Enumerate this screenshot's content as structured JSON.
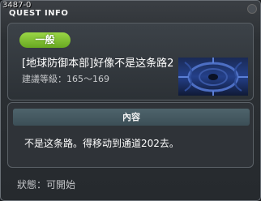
{
  "window": {
    "id": "3487-0",
    "title": "QUEST INFO"
  },
  "quest": {
    "category": "一般",
    "name": "[地球防御本部]好像不是这条路2",
    "level_label": "建議等級：",
    "level_range": "165～169",
    "level_text": "建議等級：165～169"
  },
  "content": {
    "header": "內容",
    "text": "不是这条路。得移动到通道202去。"
  },
  "status": {
    "label": "狀態：",
    "value": "可開始"
  }
}
